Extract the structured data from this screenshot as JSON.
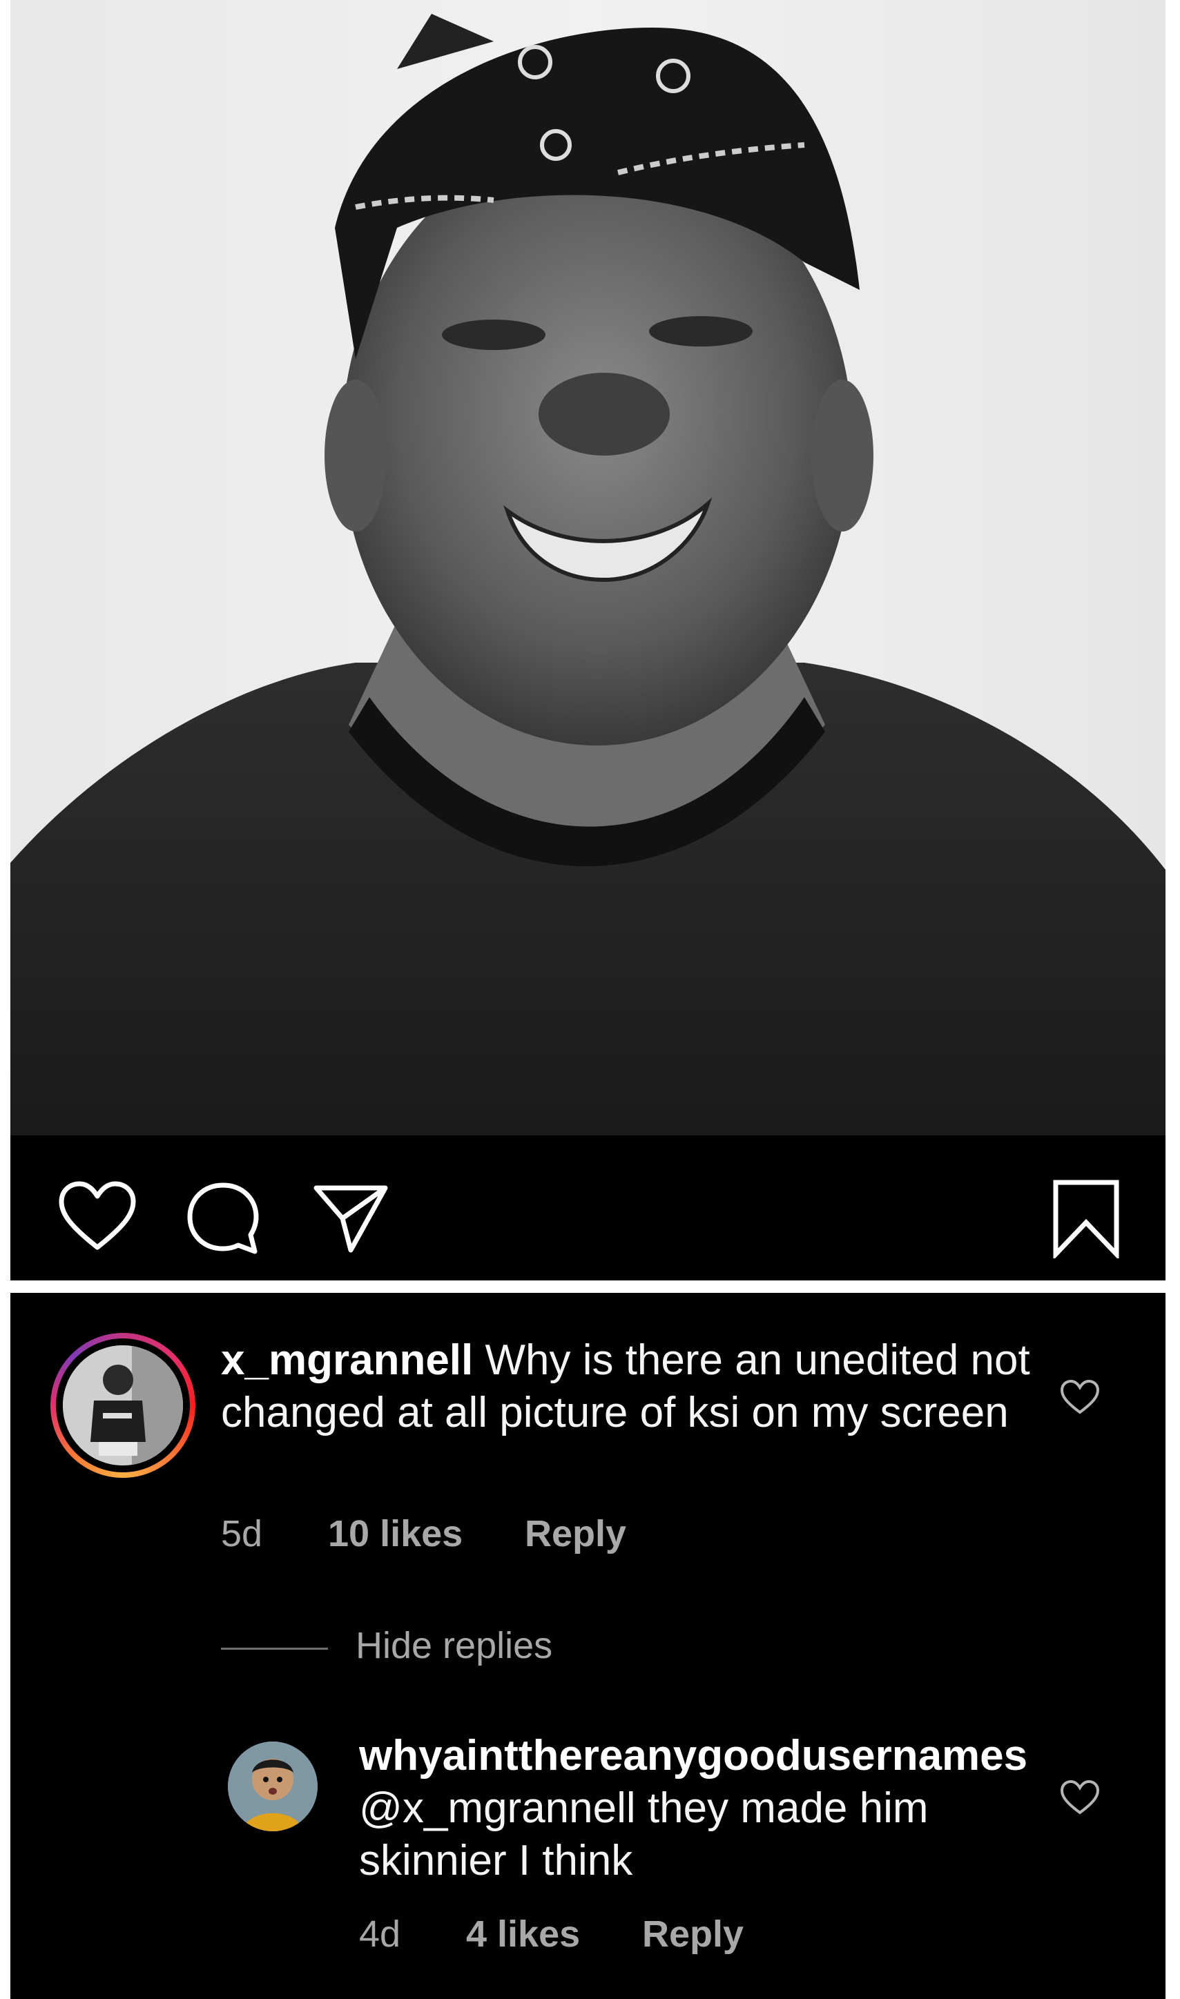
{
  "post": {
    "image_description_icon": "photo",
    "actions": {
      "like_icon": "heart-outline-icon",
      "comment_icon": "comment-bubble-icon",
      "share_icon": "paper-plane-icon",
      "save_icon": "bookmark-icon"
    }
  },
  "comments": [
    {
      "username": "x_mgrannell",
      "text": "Why is there an unedited not changed at all picture of ksi on my screen",
      "time": "5d",
      "likes": "10 likes",
      "reply_label": "Reply"
    }
  ],
  "hide_replies_label": "Hide replies",
  "replies": [
    {
      "username": "whyaintthereanygoodusernames",
      "mention": "@x_mgrannell",
      "text": " they made him skinnier I think",
      "time": "4d",
      "likes": "4 likes",
      "reply_label": "Reply"
    }
  ],
  "colors": {
    "background": "#000000",
    "text_primary": "#ffffff",
    "text_secondary": "#a8a8a8",
    "story_ring": "#e1306c"
  }
}
